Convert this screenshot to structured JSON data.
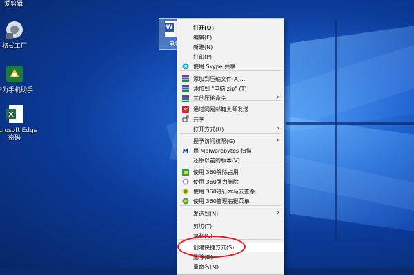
{
  "desktop": {
    "top_label": "爱剪辑",
    "icons": [
      {
        "label": "格式工厂",
        "icon": "format-factory-icon"
      },
      {
        "label": "华为手机助手",
        "icon": "huawei-assistant-icon"
      },
      {
        "label": "Microsoft Edge 密码",
        "icon": "excel-file-icon"
      }
    ],
    "selected_file": {
      "label": "电脑",
      "icon": "word-document-icon"
    }
  },
  "context_menu": {
    "items": [
      {
        "label": "打开(O)",
        "bold": true
      },
      {
        "label": "编辑(E)"
      },
      {
        "label": "新建(N)"
      },
      {
        "label": "打印(P)"
      },
      {
        "label": "使用 Skype 共享",
        "icon": "skype-icon"
      },
      {
        "label": "添加到压缩文件(A)...",
        "icon": "winrar-icon"
      },
      {
        "label": "添加到 \"电脑.zip\" (T)",
        "icon": "winrar-icon"
      },
      {
        "label": "其他压缩命令",
        "icon": "winrar-icon",
        "submenu": true
      },
      {
        "label": "通过网易邮箱大师发送",
        "icon": "netease-mail-icon"
      },
      {
        "label": "共享",
        "icon": "share-icon"
      },
      {
        "label": "打开方式(H)",
        "submenu": true
      },
      {
        "label": "授予访问权限(G)",
        "submenu": true
      },
      {
        "label": "用 Malwarebytes 扫描",
        "icon": "malwarebytes-icon"
      },
      {
        "label": "还原以前的版本(V)"
      },
      {
        "label": "使用 360解除占用",
        "icon": "360-unlock-icon"
      },
      {
        "label": "使用 360强力删除",
        "icon": "360-delete-icon"
      },
      {
        "label": "使用 360进行木马云查杀",
        "icon": "360-scan-icon"
      },
      {
        "label": "使用 360管理右键菜单",
        "icon": "360-menu-icon"
      },
      {
        "label": "发送到(N)",
        "submenu": true
      },
      {
        "label": "剪切(T)"
      },
      {
        "label": "复制(C)"
      },
      {
        "label": "创建快捷方式(S)",
        "highlighted": true
      },
      {
        "label": "删除(D)"
      },
      {
        "label": "重命名(M)"
      }
    ],
    "submenu_arrow": "›"
  },
  "colors": {
    "highlight_ring": "#e8151c",
    "menu_bg": "#f2f2f2"
  }
}
